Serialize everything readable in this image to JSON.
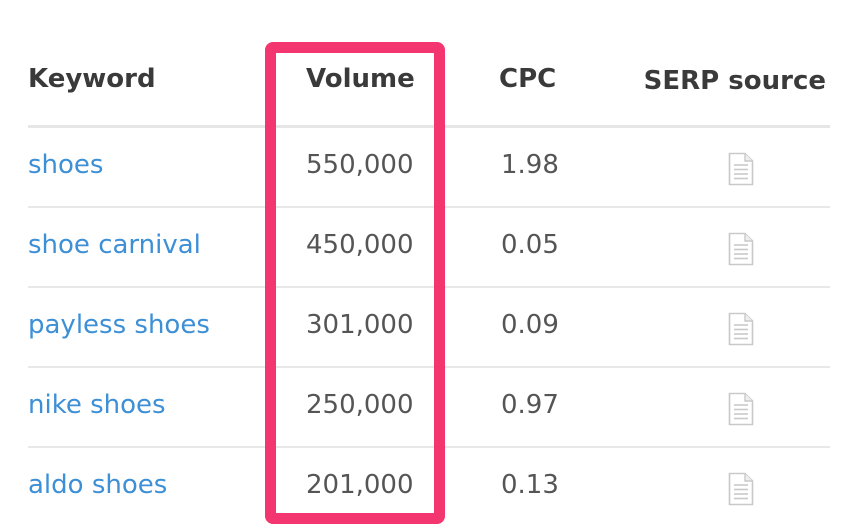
{
  "columns": {
    "keyword": "Keyword",
    "volume": "Volume",
    "cpc": "CPC",
    "serp_source": "SERP source"
  },
  "rows": [
    {
      "keyword": "shoes",
      "volume": "550,000",
      "cpc": "1.98",
      "serp_icon": "document-icon"
    },
    {
      "keyword": "shoe carnival",
      "volume": "450,000",
      "cpc": "0.05",
      "serp_icon": "document-icon"
    },
    {
      "keyword": "payless shoes",
      "volume": "301,000",
      "cpc": "0.09",
      "serp_icon": "document-icon"
    },
    {
      "keyword": "nike shoes",
      "volume": "250,000",
      "cpc": "0.97",
      "serp_icon": "document-icon"
    },
    {
      "keyword": "aldo shoes",
      "volume": "201,000",
      "cpc": "0.13",
      "serp_icon": "document-icon"
    }
  ],
  "colors": {
    "highlight": "#f33570",
    "link": "#3d8fd6",
    "header_text": "#3a3a3a",
    "body_text": "#555555",
    "divider": "#e6e6e6"
  }
}
